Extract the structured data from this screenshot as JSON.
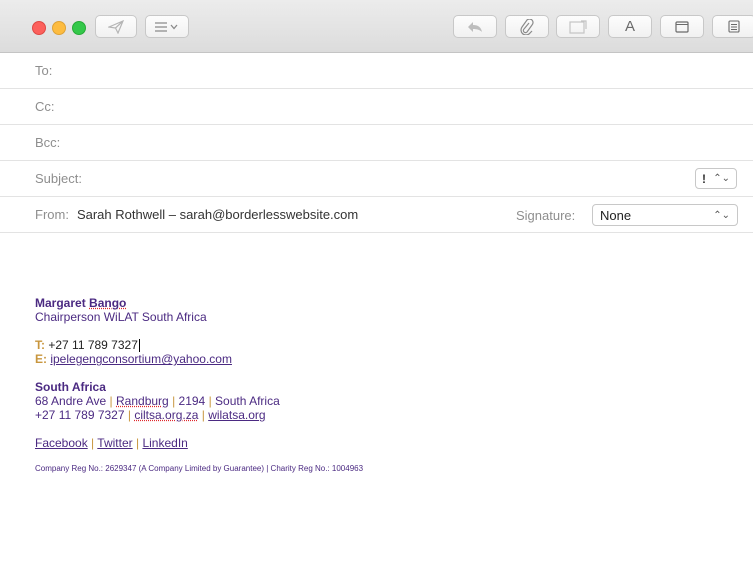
{
  "header": {
    "to_label": "To:",
    "cc_label": "Cc:",
    "bcc_label": "Bcc:",
    "subject_label": "Subject:",
    "priority_value": "!",
    "from_label": "From:",
    "from_value": "Sarah Rothwell – sarah@borderlesswebsite.com",
    "signature_label": "Signature:",
    "signature_value": "None"
  },
  "toolbar": {
    "send_icon": "paper-plane-icon",
    "format_icon": "list-icon",
    "reply_icon": "reply-arrow-icon",
    "attach_icon": "paperclip-icon",
    "photo_icon": "photo-browser-icon",
    "font_label": "A",
    "window_icon": "window-icon",
    "calendar_icon": "calendar-icon"
  },
  "signature": {
    "name_first": "Margaret",
    "name_last": "Bango",
    "title": "Chairperson WiLAT South Africa",
    "tel_label": "T:",
    "tel_value": "+27 11 789 7327",
    "email_label": "E:",
    "email_value": "ipelegengconsortium@yahoo.com",
    "region": "South Africa",
    "addr_street": "68 Andre Ave",
    "addr_city": "Randburg",
    "addr_code": "2194",
    "addr_country": "South Africa",
    "phone2": "+27 11 789 7327",
    "site1": "ciltsa.org.za",
    "site2": "wilatsa.org",
    "social": [
      "Facebook",
      "Twitter",
      "LinkedIn"
    ],
    "separator": "|",
    "reg_text": "Company Reg No.: 2629347 (A Company Limited by Guarantee) | Charity Reg No.: 1004963"
  },
  "colors": {
    "accent": "#4b2a82",
    "gold": "#c8963e"
  }
}
